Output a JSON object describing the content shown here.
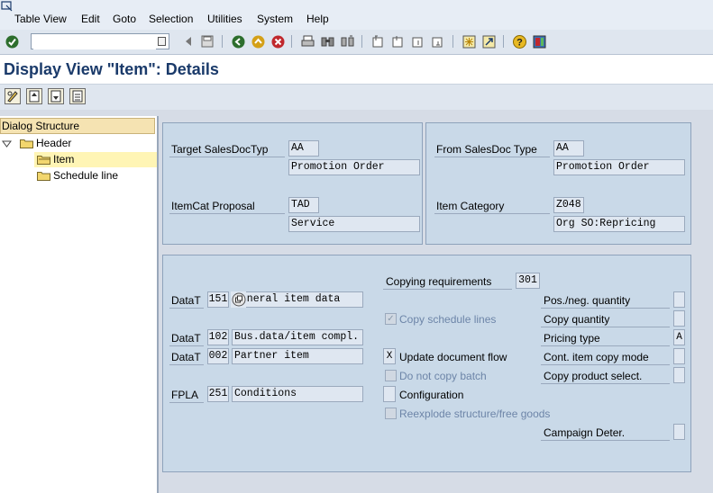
{
  "menu": [
    "Table View",
    "Edit",
    "Goto",
    "Selection",
    "Utilities",
    "System",
    "Help"
  ],
  "command_field": {
    "value": ""
  },
  "page_title": "Display View \"Item\": Details",
  "dialog_structure": {
    "title": "Dialog Structure",
    "items": [
      {
        "label": "Header"
      },
      {
        "label": "Item"
      },
      {
        "label": "Schedule line"
      }
    ]
  },
  "top_left": {
    "target_sales_doc_label": "Target SalesDocTyp",
    "target_sales_doc_value": "AA",
    "target_sales_doc_desc": "Promotion Order",
    "itemcat_proposal_label": "ItemCat Proposal",
    "itemcat_proposal_value": "TAD",
    "itemcat_proposal_desc": "Service"
  },
  "top_right": {
    "from_sales_doc_label": "From SalesDoc Type",
    "from_sales_doc_value": "AA",
    "from_sales_doc_desc": "Promotion Order",
    "item_category_label": "Item Category",
    "item_category_value": "Z048",
    "item_category_desc": "Org SO:Repricing"
  },
  "copy": {
    "copying_requirements_label": "Copying requirements",
    "copying_requirements_value": "301",
    "datat_label": "DataT",
    "fpla_label": "FPLA",
    "rows": [
      {
        "code": "151",
        "desc": "General item data"
      },
      {
        "code": "102",
        "desc": "Bus.data/item compl."
      },
      {
        "code": "002",
        "desc": "Partner item"
      },
      {
        "code": "251",
        "desc": "Conditions"
      }
    ],
    "copy_schedule_lines": "Copy schedule lines",
    "update_document_flow": "Update document flow",
    "update_document_flow_value": "X",
    "do_not_copy_batch": "Do not copy batch",
    "configuration": "Configuration",
    "reexplode": "Reexplode structure/free goods",
    "pos_neg_quantity": "Pos./neg. quantity",
    "copy_quantity": "Copy quantity",
    "pricing_type": "Pricing type",
    "pricing_type_value": "A",
    "cont_item_copy_mode": "Cont. item copy mode",
    "copy_product_select": "Copy product select.",
    "campaign_deter": "Campaign Deter."
  }
}
